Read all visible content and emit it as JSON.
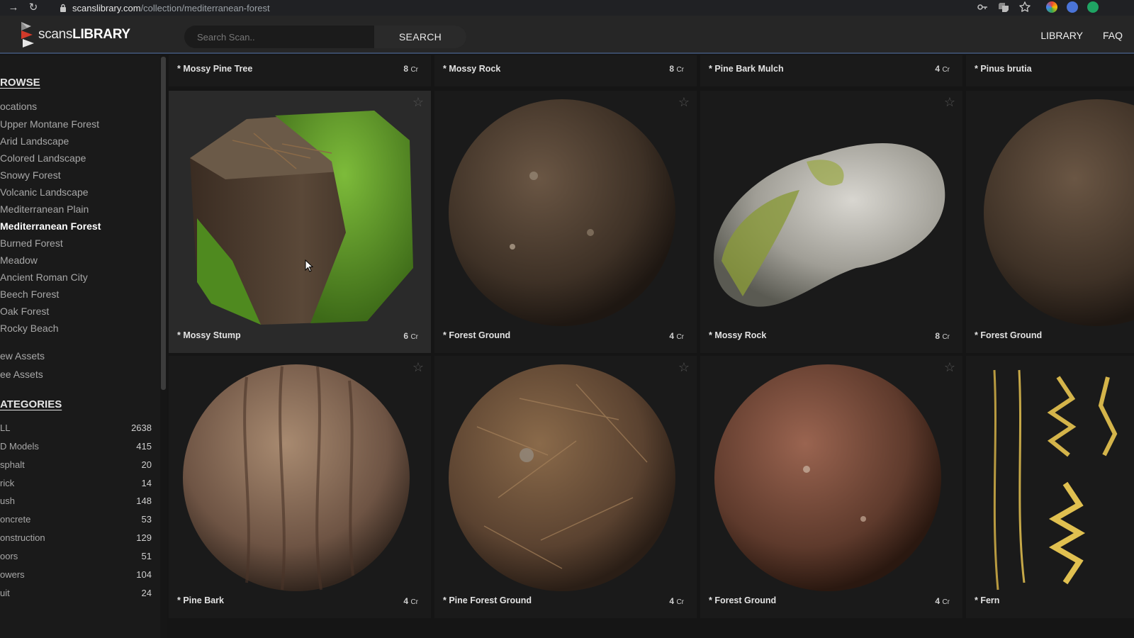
{
  "browser": {
    "url_host": "scanslibrary.com",
    "url_path": "/collection/mediterranean-forest"
  },
  "header": {
    "logo_light": "scans",
    "logo_bold": "LIBRARY",
    "search_placeholder": "Search Scan..",
    "search_button": "SEARCH",
    "nav": [
      "LIBRARY",
      "FAQ"
    ]
  },
  "sidebar": {
    "browse_title": "ROWSE",
    "locations_label": "ocations",
    "locations": [
      "Upper Montane Forest",
      "Arid Landscape",
      "Colored Landscape",
      "Snowy Forest",
      "Volcanic Landscape",
      "Mediterranean Plain",
      "Mediterranean Forest",
      "Burned Forest",
      "Meadow",
      "Ancient Roman City",
      "Beech Forest",
      "Oak Forest",
      "Rocky Beach"
    ],
    "active_location": "Mediterranean Forest",
    "new_assets": "ew Assets",
    "free_assets": "ee Assets",
    "categories_title": "ATEGORIES",
    "categories": [
      {
        "label": "LL",
        "count": "2638"
      },
      {
        "label": "D Models",
        "count": "415"
      },
      {
        "label": "sphalt",
        "count": "20"
      },
      {
        "label": "rick",
        "count": "14"
      },
      {
        "label": "ush",
        "count": "148"
      },
      {
        "label": "oncrete",
        "count": "53"
      },
      {
        "label": "onstruction",
        "count": "129"
      },
      {
        "label": "oors",
        "count": "51"
      },
      {
        "label": "owers",
        "count": "104"
      },
      {
        "label": "uit",
        "count": "24"
      }
    ]
  },
  "top_row": [
    {
      "name": "* Mossy Pine Tree",
      "price": "8",
      "unit": "Cr"
    },
    {
      "name": "* Mossy Rock",
      "price": "8",
      "unit": "Cr"
    },
    {
      "name": "* Pine Bark Mulch",
      "price": "4",
      "unit": "Cr"
    },
    {
      "name": "* Pinus brutia",
      "price": "",
      "unit": ""
    }
  ],
  "cards": [
    {
      "name": "* Mossy Stump",
      "price": "6",
      "unit": "Cr",
      "thumb": "stump",
      "hover": true
    },
    {
      "name": "* Forest Ground",
      "price": "4",
      "unit": "Cr",
      "thumb": "soil-dark"
    },
    {
      "name": "* Mossy Rock",
      "price": "8",
      "unit": "Cr",
      "thumb": "rock"
    },
    {
      "name": "* Forest Ground",
      "price": "",
      "unit": "",
      "thumb": "soil-dark"
    },
    {
      "name": "* Pine Bark",
      "price": "4",
      "unit": "Cr",
      "thumb": "bark"
    },
    {
      "name": "* Pine Forest Ground",
      "price": "4",
      "unit": "Cr",
      "thumb": "needles"
    },
    {
      "name": "* Forest Ground",
      "price": "4",
      "unit": "Cr",
      "thumb": "soil-red"
    },
    {
      "name": "* Fern",
      "price": "",
      "unit": "",
      "thumb": "fern"
    }
  ],
  "colors": {
    "accent_line": "#3a4a66",
    "header_bg": "#262626",
    "page_bg": "#151515"
  }
}
